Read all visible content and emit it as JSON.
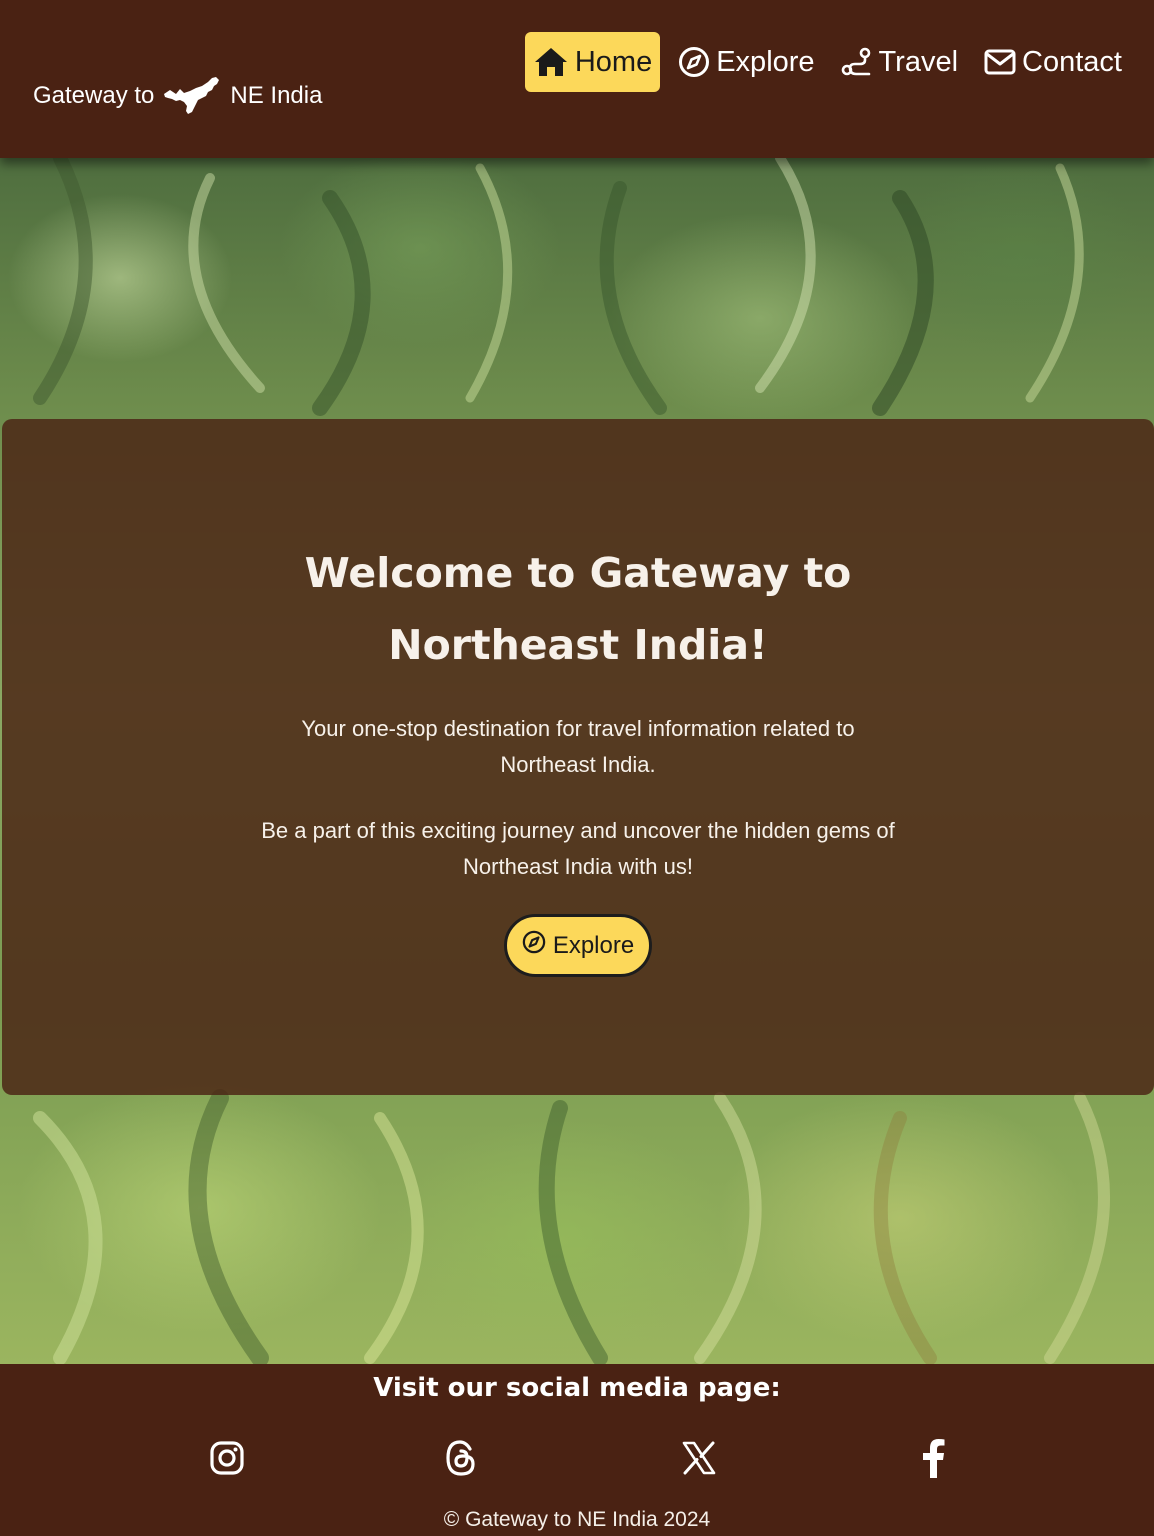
{
  "header": {
    "brand_prefix": "Gateway to",
    "brand_suffix": "NE India",
    "brand_icon": "northeast-india-map-icon"
  },
  "nav": {
    "items": [
      {
        "label": "Home",
        "icon": "home-icon",
        "active": true
      },
      {
        "label": "Explore",
        "icon": "compass-icon",
        "active": false
      },
      {
        "label": "Travel",
        "icon": "route-icon",
        "active": false
      },
      {
        "label": "Contact",
        "icon": "envelope-icon",
        "active": false
      }
    ]
  },
  "hero": {
    "title": "Welcome to Gateway to Northeast India!",
    "paragraph1": "Your one-stop destination for travel information related to Northeast India.",
    "paragraph2": "Be a part of this exciting journey and uncover the hidden gems of Northeast India with us!",
    "button_label": "Explore",
    "button_icon": "compass-icon"
  },
  "footer": {
    "heading": "Visit our social media page:",
    "social": [
      {
        "name": "instagram",
        "icon": "instagram-icon"
      },
      {
        "name": "threads",
        "icon": "threads-icon"
      },
      {
        "name": "x",
        "icon": "x-icon"
      },
      {
        "name": "facebook",
        "icon": "facebook-icon"
      }
    ],
    "copyright": "© Gateway to NE India 2024"
  },
  "colors": {
    "brown": "#4a2213",
    "accent_yellow": "#fcd85a",
    "text_light": "#f7f1ea"
  }
}
